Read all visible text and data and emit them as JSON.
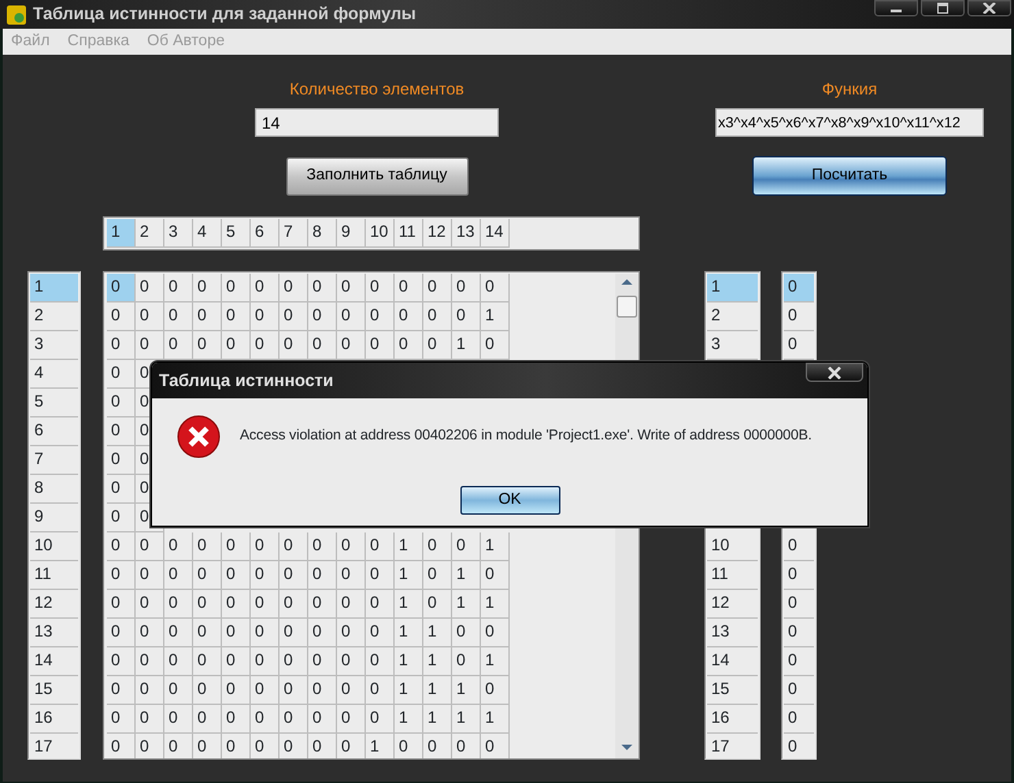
{
  "window": {
    "title": "Таблица истинности для заданной формулы"
  },
  "menu": [
    "Файл",
    "Справка",
    "Об Авторе"
  ],
  "count": {
    "label": "Количество элементов",
    "value": "14"
  },
  "fill_button": "Заполнить таблицу",
  "function": {
    "label": "Функия",
    "value": "x3^x4^x5^x6^x7^x8^x9^x10^x11^x12"
  },
  "calc_button": "Посчитать",
  "header": {
    "columns": [
      {
        "label": "1",
        "selected": true
      },
      {
        "label": "2",
        "selected": false
      },
      {
        "label": "3",
        "selected": false
      },
      {
        "label": "4",
        "selected": false
      },
      {
        "label": "5",
        "selected": false
      },
      {
        "label": "6",
        "selected": false
      },
      {
        "label": "7",
        "selected": false
      },
      {
        "label": "8",
        "selected": false
      },
      {
        "label": "9",
        "selected": false
      },
      {
        "label": "10",
        "selected": false
      },
      {
        "label": "11",
        "selected": false
      },
      {
        "label": "12",
        "selected": false
      },
      {
        "label": "13",
        "selected": false
      },
      {
        "label": "14",
        "selected": false
      }
    ]
  },
  "index_list": {
    "items": [
      {
        "label": "1",
        "selected": true
      },
      {
        "label": "2",
        "selected": false
      },
      {
        "label": "3",
        "selected": false
      },
      {
        "label": "4",
        "selected": false
      },
      {
        "label": "5",
        "selected": false
      },
      {
        "label": "6",
        "selected": false
      },
      {
        "label": "7",
        "selected": false
      },
      {
        "label": "8",
        "selected": false
      },
      {
        "label": "9",
        "selected": false
      },
      {
        "label": "10",
        "selected": false
      },
      {
        "label": "11",
        "selected": false
      },
      {
        "label": "12",
        "selected": false
      },
      {
        "label": "13",
        "selected": false
      },
      {
        "label": "14",
        "selected": false
      },
      {
        "label": "15",
        "selected": false
      },
      {
        "label": "16",
        "selected": false
      },
      {
        "label": "17",
        "selected": false
      }
    ]
  },
  "grid": {
    "rows": [
      {
        "cells": [
          "0",
          "0",
          "0",
          "0",
          "0",
          "0",
          "0",
          "0",
          "0",
          "0",
          "0",
          "0",
          "0",
          "0"
        ],
        "selected": true
      },
      {
        "cells": [
          "0",
          "0",
          "0",
          "0",
          "0",
          "0",
          "0",
          "0",
          "0",
          "0",
          "0",
          "0",
          "0",
          "1"
        ],
        "selected": false
      },
      {
        "cells": [
          "0",
          "0",
          "0",
          "0",
          "0",
          "0",
          "0",
          "0",
          "0",
          "0",
          "0",
          "0",
          "1",
          "0"
        ],
        "selected": false
      },
      {
        "cells": [
          "0",
          "0"
        ],
        "selected": false
      },
      {
        "cells": [
          "0",
          "0"
        ],
        "selected": false
      },
      {
        "cells": [
          "0",
          "0"
        ],
        "selected": false
      },
      {
        "cells": [
          "0",
          "0"
        ],
        "selected": false
      },
      {
        "cells": [
          "0",
          "0"
        ],
        "selected": false
      },
      {
        "cells": [
          "0",
          "0"
        ],
        "selected": false
      },
      {
        "cells": [
          "0",
          "0",
          "0",
          "0",
          "0",
          "0",
          "0",
          "0",
          "0",
          "0",
          "1",
          "0",
          "0",
          "1"
        ],
        "selected": false
      },
      {
        "cells": [
          "0",
          "0",
          "0",
          "0",
          "0",
          "0",
          "0",
          "0",
          "0",
          "0",
          "1",
          "0",
          "1",
          "0"
        ],
        "selected": false
      },
      {
        "cells": [
          "0",
          "0",
          "0",
          "0",
          "0",
          "0",
          "0",
          "0",
          "0",
          "0",
          "1",
          "0",
          "1",
          "1"
        ],
        "selected": false
      },
      {
        "cells": [
          "0",
          "0",
          "0",
          "0",
          "0",
          "0",
          "0",
          "0",
          "0",
          "0",
          "1",
          "1",
          "0",
          "0"
        ],
        "selected": false
      },
      {
        "cells": [
          "0",
          "0",
          "0",
          "0",
          "0",
          "0",
          "0",
          "0",
          "0",
          "0",
          "1",
          "1",
          "0",
          "1"
        ],
        "selected": false
      },
      {
        "cells": [
          "0",
          "0",
          "0",
          "0",
          "0",
          "0",
          "0",
          "0",
          "0",
          "0",
          "1",
          "1",
          "1",
          "0"
        ],
        "selected": false
      },
      {
        "cells": [
          "0",
          "0",
          "0",
          "0",
          "0",
          "0",
          "0",
          "0",
          "0",
          "0",
          "1",
          "1",
          "1",
          "1"
        ],
        "selected": false
      },
      {
        "cells": [
          "0",
          "0",
          "0",
          "0",
          "0",
          "0",
          "0",
          "0",
          "0",
          "1",
          "0",
          "0",
          "0",
          "0"
        ],
        "selected": false
      }
    ]
  },
  "row_list": {
    "upper": [
      {
        "label": "1",
        "selected": true
      },
      {
        "label": "2",
        "selected": false
      },
      {
        "label": "3",
        "selected": false
      }
    ],
    "lower": [
      {
        "label": "10",
        "selected": false
      },
      {
        "label": "11",
        "selected": false
      },
      {
        "label": "12",
        "selected": false
      },
      {
        "label": "13",
        "selected": false
      },
      {
        "label": "14",
        "selected": false
      },
      {
        "label": "15",
        "selected": false
      },
      {
        "label": "16",
        "selected": false
      },
      {
        "label": "17",
        "selected": false
      }
    ]
  },
  "result_list": {
    "upper": [
      {
        "label": "0",
        "selected": true
      },
      {
        "label": "0",
        "selected": false
      },
      {
        "label": "0",
        "selected": false
      }
    ],
    "lower": [
      {
        "label": "0",
        "selected": false
      },
      {
        "label": "0",
        "selected": false
      },
      {
        "label": "0",
        "selected": false
      },
      {
        "label": "0",
        "selected": false
      },
      {
        "label": "0",
        "selected": false
      },
      {
        "label": "0",
        "selected": false
      },
      {
        "label": "0",
        "selected": false
      },
      {
        "label": "0",
        "selected": false
      }
    ]
  },
  "dialog": {
    "title": "Таблица истинности",
    "message": "Access violation at address 00402206 in module 'Project1.exe'. Write of address 0000000B.",
    "button": "OK"
  }
}
